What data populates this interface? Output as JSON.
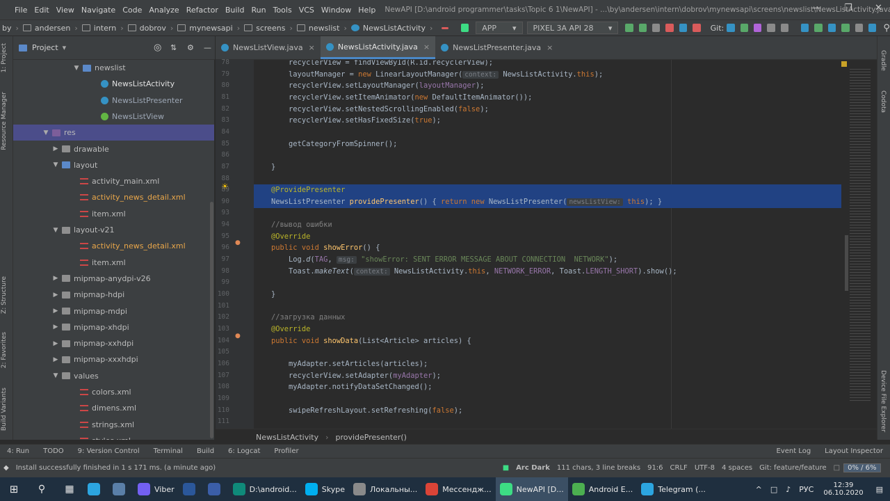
{
  "window": {
    "menu": [
      "File",
      "Edit",
      "View",
      "Navigate",
      "Code",
      "Analyze",
      "Refactor",
      "Build",
      "Run",
      "Tools",
      "VCS",
      "Window",
      "Help"
    ],
    "title": "NewAPI [D:\\android programmer\\tasks\\Topic 6 1\\NewAPI] - ...\\by\\andersen\\intern\\dobrov\\mynewsapi\\screens\\newslist\\NewsListActivity.java [app]"
  },
  "navbar": {
    "crumbs": [
      "by",
      "andersen",
      "intern",
      "dobrov",
      "mynewsapi",
      "screens",
      "newslist",
      "NewsListActivity"
    ],
    "run_config": "APP",
    "device": "PIXEL 3A API 28",
    "git_label": "Git:"
  },
  "project_panel": {
    "title": "Project",
    "tree": [
      {
        "label": "newslist",
        "icon": "folder-blue-icon",
        "arrow": "▼",
        "indent": 104
      },
      {
        "label": "NewsListActivity",
        "icon": "java-class-icon",
        "arrow": "",
        "indent": 130
      },
      {
        "label": "NewsListPresenter",
        "icon": "java-class-icon",
        "arrow": "",
        "indent": 130
      },
      {
        "label": "NewsListView",
        "icon": "interface-icon",
        "arrow": "",
        "indent": 130
      },
      {
        "label": "res",
        "icon": "res-folder-icon",
        "arrow": "▼",
        "indent": 60,
        "selected": true
      },
      {
        "label": "drawable",
        "icon": "folder-icon",
        "arrow": "▶",
        "indent": 74
      },
      {
        "label": "layout",
        "icon": "folder-blue-icon",
        "arrow": "▼",
        "indent": 74
      },
      {
        "label": "activity_main.xml",
        "icon": "xml-file-icon",
        "arrow": "",
        "indent": 100
      },
      {
        "label": "activity_news_detail.xml",
        "icon": "xml-file-icon",
        "arrow": "",
        "indent": 100,
        "modified": true
      },
      {
        "label": "item.xml",
        "icon": "xml-file-icon",
        "arrow": "",
        "indent": 100
      },
      {
        "label": "layout-v21",
        "icon": "folder-icon",
        "arrow": "▼",
        "indent": 74
      },
      {
        "label": "activity_news_detail.xml",
        "icon": "xml-file-icon",
        "arrow": "",
        "indent": 100,
        "modified": true
      },
      {
        "label": "item.xml",
        "icon": "xml-file-icon",
        "arrow": "",
        "indent": 100
      },
      {
        "label": "mipmap-anydpi-v26",
        "icon": "folder-icon",
        "arrow": "▶",
        "indent": 74
      },
      {
        "label": "mipmap-hdpi",
        "icon": "folder-icon",
        "arrow": "▶",
        "indent": 74
      },
      {
        "label": "mipmap-mdpi",
        "icon": "folder-icon",
        "arrow": "▶",
        "indent": 74
      },
      {
        "label": "mipmap-xhdpi",
        "icon": "folder-icon",
        "arrow": "▶",
        "indent": 74
      },
      {
        "label": "mipmap-xxhdpi",
        "icon": "folder-icon",
        "arrow": "▶",
        "indent": 74
      },
      {
        "label": "mipmap-xxxhdpi",
        "icon": "folder-icon",
        "arrow": "▶",
        "indent": 74
      },
      {
        "label": "values",
        "icon": "folder-icon",
        "arrow": "▼",
        "indent": 74
      },
      {
        "label": "colors.xml",
        "icon": "xml-file-icon",
        "arrow": "",
        "indent": 100
      },
      {
        "label": "dimens.xml",
        "icon": "xml-file-icon",
        "arrow": "",
        "indent": 100
      },
      {
        "label": "strings.xml",
        "icon": "xml-file-icon",
        "arrow": "",
        "indent": 100
      },
      {
        "label": "styles.xml",
        "icon": "xml-file-icon",
        "arrow": "",
        "indent": 100
      }
    ]
  },
  "side_tabs": {
    "left": [
      "1: Project",
      "Resource Manager",
      "Z: Structure",
      "2: Favorites",
      "Build Variants"
    ],
    "right": [
      "Gradle",
      "Codota",
      "Device File Explorer"
    ]
  },
  "editor_tabs": [
    {
      "label": "NewsListView.java",
      "active": false
    },
    {
      "label": "NewsListActivity.java",
      "active": true
    },
    {
      "label": "NewsListPresenter.java",
      "active": false
    }
  ],
  "code_lines": [
    {
      "n": "78",
      "html": "        recyclerView = findViewById(R.id.recyclerView);"
    },
    {
      "n": "79",
      "parts": [
        [
          "        layoutManager = ",
          ""
        ],
        [
          "new ",
          "kw"
        ],
        [
          "LinearLayoutManager(",
          ""
        ],
        [
          "context:",
          "hint"
        ],
        [
          " NewsListActivity.",
          ""
        ],
        [
          "this",
          "kw"
        ],
        [
          ");",
          ""
        ]
      ]
    },
    {
      "n": "80",
      "parts": [
        [
          "        recyclerView.setLayoutManager(",
          ""
        ],
        [
          "layoutManager",
          "fld"
        ],
        [
          ");",
          ""
        ]
      ]
    },
    {
      "n": "81",
      "parts": [
        [
          "        recyclerView.setItemAnimator(",
          ""
        ],
        [
          "new ",
          "kw"
        ],
        [
          "DefaultItemAnimator());",
          ""
        ]
      ]
    },
    {
      "n": "82",
      "parts": [
        [
          "        recyclerView.setNestedScrollingEnabled(",
          ""
        ],
        [
          "false",
          "kw"
        ],
        [
          ");",
          ""
        ]
      ]
    },
    {
      "n": "83",
      "parts": [
        [
          "        recyclerView.setHasFixedSize(",
          ""
        ],
        [
          "true",
          "kw"
        ],
        [
          ");",
          ""
        ]
      ]
    },
    {
      "n": "84",
      "parts": [
        [
          "",
          ""
        ]
      ]
    },
    {
      "n": "85",
      "parts": [
        [
          "        getCategoryFromSpinner();",
          ""
        ]
      ]
    },
    {
      "n": "86",
      "parts": [
        [
          "",
          ""
        ]
      ]
    },
    {
      "n": "87",
      "parts": [
        [
          "    }",
          ""
        ]
      ]
    },
    {
      "n": "88",
      "parts": [
        [
          "",
          ""
        ]
      ]
    },
    {
      "n": "89",
      "parts": [
        [
          "    ",
          ""
        ],
        [
          "@ProvidePresenter",
          "ann"
        ]
      ],
      "hl": true
    },
    {
      "n": "90",
      "parts": [
        [
          "    NewsListPresenter ",
          ""
        ],
        [
          "providePresenter",
          "mth"
        ],
        [
          "() { ",
          ""
        ],
        [
          "return new ",
          "kw"
        ],
        [
          "NewsListPresenter(",
          ""
        ],
        [
          "newsListView:",
          "hint"
        ],
        [
          " ",
          ""
        ],
        [
          "this",
          "kw"
        ],
        [
          "); }",
          ""
        ]
      ],
      "hl": true
    },
    {
      "n": "93",
      "parts": [
        [
          "",
          ""
        ]
      ]
    },
    {
      "n": "94",
      "parts": [
        [
          "    //вывод ошибки",
          "cmt"
        ]
      ]
    },
    {
      "n": "95",
      "parts": [
        [
          "    ",
          ""
        ],
        [
          "@Override",
          "ann"
        ]
      ]
    },
    {
      "n": "96",
      "parts": [
        [
          "    ",
          ""
        ],
        [
          "public void ",
          "kw"
        ],
        [
          "showError",
          "mth"
        ],
        [
          "() {",
          ""
        ]
      ]
    },
    {
      "n": "97",
      "parts": [
        [
          "        Log.",
          ""
        ],
        [
          "d",
          "it"
        ],
        [
          "(",
          ""
        ],
        [
          "TAG",
          "fld"
        ],
        [
          ", ",
          ""
        ],
        [
          "msg:",
          "hint"
        ],
        [
          " ",
          ""
        ],
        [
          "\"showError: SENT ERROR MESSAGE ABOUT CONNECTION  NETWORK\"",
          "str"
        ],
        [
          ");",
          ""
        ]
      ]
    },
    {
      "n": "98",
      "parts": [
        [
          "        Toast.",
          ""
        ],
        [
          "makeText",
          "it"
        ],
        [
          "(",
          ""
        ],
        [
          "context:",
          "hint"
        ],
        [
          " NewsListActivity.",
          ""
        ],
        [
          "this",
          "kw"
        ],
        [
          ", ",
          ""
        ],
        [
          "NETWORK_ERROR",
          "fld"
        ],
        [
          ", Toast.",
          ""
        ],
        [
          "LENGTH_SHORT",
          "fld"
        ],
        [
          ").show();",
          ""
        ]
      ]
    },
    {
      "n": "99",
      "parts": [
        [
          "",
          ""
        ]
      ]
    },
    {
      "n": "100",
      "parts": [
        [
          "    }",
          ""
        ]
      ]
    },
    {
      "n": "101",
      "parts": [
        [
          "",
          ""
        ]
      ]
    },
    {
      "n": "102",
      "parts": [
        [
          "    //загрузка данных",
          "cmt"
        ]
      ]
    },
    {
      "n": "103",
      "parts": [
        [
          "    ",
          ""
        ],
        [
          "@Override",
          "ann"
        ]
      ]
    },
    {
      "n": "104",
      "parts": [
        [
          "    ",
          ""
        ],
        [
          "public void ",
          "kw"
        ],
        [
          "showData",
          "mth"
        ],
        [
          "(List<Article> articles) {",
          ""
        ]
      ]
    },
    {
      "n": "105",
      "parts": [
        [
          "",
          ""
        ]
      ]
    },
    {
      "n": "106",
      "parts": [
        [
          "        myAdapter.setArticles(articles);",
          ""
        ]
      ]
    },
    {
      "n": "107",
      "parts": [
        [
          "        recyclerView.setAdapter(",
          ""
        ],
        [
          "myAdapter",
          "fld"
        ],
        [
          ");",
          ""
        ]
      ]
    },
    {
      "n": "108",
      "parts": [
        [
          "        myAdapter.notifyDataSetChanged();",
          ""
        ]
      ]
    },
    {
      "n": "109",
      "parts": [
        [
          "",
          ""
        ]
      ]
    },
    {
      "n": "110",
      "parts": [
        [
          "        swipeRefreshLayout.setRefreshing(",
          ""
        ],
        [
          "false",
          "kw"
        ],
        [
          ");",
          ""
        ]
      ]
    },
    {
      "n": "111",
      "parts": [
        [
          "",
          ""
        ]
      ]
    }
  ],
  "editor_breadcrumb": [
    "NewsListActivity",
    "providePresenter()"
  ],
  "bottom_tabs": [
    "4: Run",
    "TODO",
    "9: Version Control",
    "Terminal",
    "Build",
    "6: Logcat",
    "Profiler",
    "Event Log",
    "Layout Inspector"
  ],
  "status": {
    "message": "Install successfully finished in 1 s 171 ms. (a minute ago)",
    "theme": "Arc Dark",
    "selection": "111 chars, 3 line breaks",
    "position": "91:6",
    "line_sep": "CRLF",
    "encoding": "UTF-8",
    "indent": "4 spaces",
    "branch": "Git: feature/feature",
    "memory": "0% / 6%"
  },
  "taskbar": {
    "items": [
      {
        "label": "",
        "icon": "telegram-icon",
        "color": "#2ca5e0"
      },
      {
        "label": "",
        "icon": "notes-icon",
        "color": "#5a7fa8"
      },
      {
        "label": "Viber",
        "icon": "viber-icon",
        "color": "#7360f2"
      },
      {
        "label": "",
        "icon": "word-icon",
        "color": "#2b579a"
      },
      {
        "label": "",
        "icon": "save-icon",
        "color": "#3b5ea8"
      },
      {
        "label": "D:\\android...",
        "icon": "powershell-icon",
        "color": "#0f8a7a"
      },
      {
        "label": "Skype",
        "icon": "skype-icon",
        "color": "#00aff0"
      },
      {
        "label": "Локальны...",
        "icon": "drive-icon",
        "color": "#8a8a8a"
      },
      {
        "label": "Мессендж...",
        "icon": "chrome-icon",
        "color": "#db4437"
      },
      {
        "label": "NewAPI [D...",
        "icon": "android-studio-icon",
        "color": "#3ddc84",
        "active": true
      },
      {
        "label": "Android E...",
        "icon": "android-emulator-icon",
        "color": "#4caf50"
      },
      {
        "label": "Telegram (...",
        "icon": "telegram-icon",
        "color": "#2ca5e0"
      }
    ],
    "lang": "РУС",
    "time": "12:39",
    "date": "06.10.2020"
  }
}
